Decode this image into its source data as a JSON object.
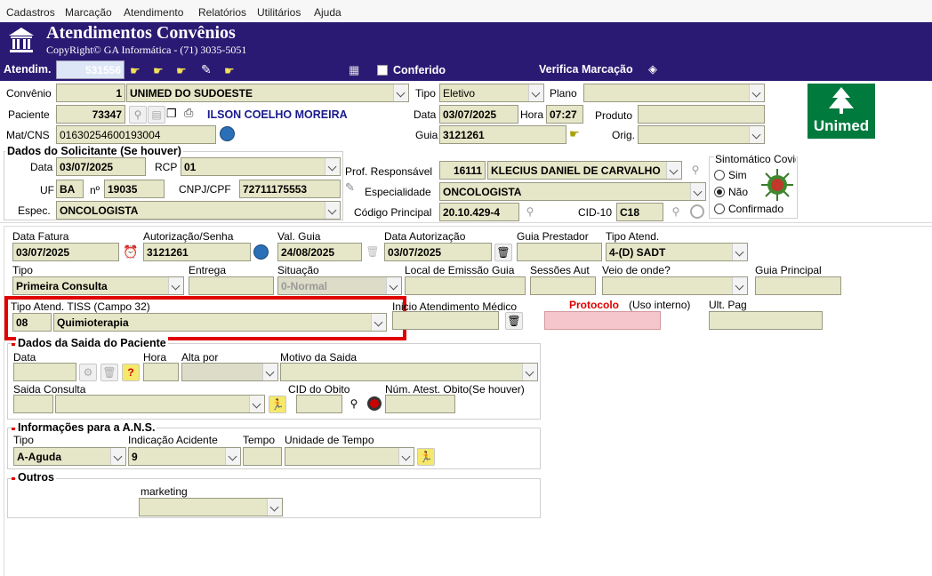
{
  "menu": [
    "Cadastros",
    "Marcação",
    "Atendimento",
    "Relatórios",
    "Utilitários",
    "Ajuda"
  ],
  "banner": {
    "title": "Atendimentos Convênios",
    "copyright": "CopyRight© GA Informática - (71) 3035-5051"
  },
  "toolbar": {
    "atendim_label": "Atendim.",
    "atendim_value": "531556",
    "conferido_label": "Conferido",
    "verifica_label": "Verifica Marcação"
  },
  "header": {
    "convenio_label": "Convênio",
    "convenio_code": "1",
    "convenio_name": "UNIMED DO SUDOESTE",
    "tipo_label": "Tipo",
    "tipo_value": "Eletivo",
    "plano_label": "Plano",
    "plano_value": "",
    "paciente_label": "Paciente",
    "paciente_code": "73347",
    "paciente_name": "ILSON COELHO MOREIRA",
    "data_label": "Data",
    "data_value": "03/07/2025",
    "hora_label": "Hora",
    "hora_value": "07:27",
    "produto_label": "Produto",
    "produto_value": "",
    "matcns_label": "Mat/CNS",
    "matcns_value": "01630254600193004",
    "guia_label": "Guia",
    "guia_value": "3121261",
    "orig_label": "Orig.",
    "orig_value": "",
    "logo_text": "Unimed"
  },
  "solicitante": {
    "title": "Dados do Solicitante (Se houver)",
    "data_label": "Data",
    "data_value": "03/07/2025",
    "rcp_label": "RCP",
    "rcp_value": "01",
    "uf_label": "UF",
    "uf_value": "BA",
    "n_label": "nº",
    "n_value": "19035",
    "cnpj_label": "CNPJ/CPF",
    "cnpj_value": "72711175553",
    "espec_label": "Espec.",
    "espec_value": "ONCOLOGISTA"
  },
  "profissional": {
    "prof_label": "Prof. Responsável",
    "prof_code": "16111",
    "prof_name": "KLECIUS DANIEL DE CARVALHO",
    "espec_label": "Especialidade",
    "espec_value": "ONCOLOGISTA",
    "codigo_label": "Código Principal",
    "codigo_value": "20.10.429-4",
    "cid_label": "CID-10",
    "cid_value": "C18"
  },
  "covid": {
    "title": "Sintomático Covid",
    "options": [
      "Sim",
      "Não",
      "Confirmado"
    ],
    "selected": "Não"
  },
  "fatura": {
    "data_fatura_label": "Data Fatura",
    "data_fatura_value": "03/07/2025",
    "autorizacao_label": "Autorização/Senha",
    "autorizacao_value": "3121261",
    "val_guia_label": "Val. Guia",
    "val_guia_value": "24/08/2025",
    "data_autorizacao_label": "Data Autorização",
    "data_autorizacao_value": "03/07/2025",
    "guia_prestador_label": "Guia Prestador",
    "guia_prestador_value": "",
    "tipo_atend_label": "Tipo Atend.",
    "tipo_atend_value": "4-(D) SADT",
    "tipo_label": "Tipo",
    "tipo_value": "Primeira Consulta",
    "entrega_label": "Entrega",
    "entrega_value": "",
    "situacao_label": "Situação",
    "situacao_value": "0-Normal",
    "local_emissao_label": "Local de Emissão Guia",
    "local_emissao_value": "",
    "sessoes_label": "Sessões Aut",
    "sessoes_value": "",
    "veio_label": "Veio de onde?",
    "veio_value": "",
    "guia_principal_label": "Guia Principal",
    "guia_principal_value": "",
    "tiss_label": "Tipo Atend. TISS (Campo 32)",
    "tiss_code": "08",
    "tiss_value": "Quimioterapia",
    "inicio_label": "Inicio Atendimento Médico",
    "inicio_value": "",
    "protocolo_label": "Protocolo",
    "protocolo_sub": "(Uso interno)",
    "protocolo_value": "",
    "ult_pag_label": "Ult. Pag",
    "ult_pag_value": ""
  },
  "saida": {
    "title": "Dados da Saida do Paciente",
    "data_label": "Data",
    "hora_label": "Hora",
    "alta_label": "Alta por",
    "motivo_label": "Motivo da Saida",
    "saida_consulta_label": "Saida Consulta",
    "cid_obito_label": "CID do Obito",
    "num_atest_label": "Núm. Atest. Obito(Se houver)"
  },
  "ans": {
    "title": "Informações para a A.N.S.",
    "tipo_label": "Tipo",
    "tipo_value": "A-Aguda",
    "indicacao_label": "Indicação Acidente",
    "indicacao_value": "9",
    "tempo_label": "Tempo",
    "tempo_value": "",
    "unidade_label": "Unidade de Tempo",
    "unidade_value": ""
  },
  "outros": {
    "title": "Outros",
    "marketing_label": "marketing",
    "marketing_value": ""
  },
  "colors": {
    "banner": "#2b1a73",
    "field": "#e6e6c8",
    "highlight": "#e00000",
    "protocolo": "#f5c6cb",
    "unimed": "#007a3d"
  }
}
